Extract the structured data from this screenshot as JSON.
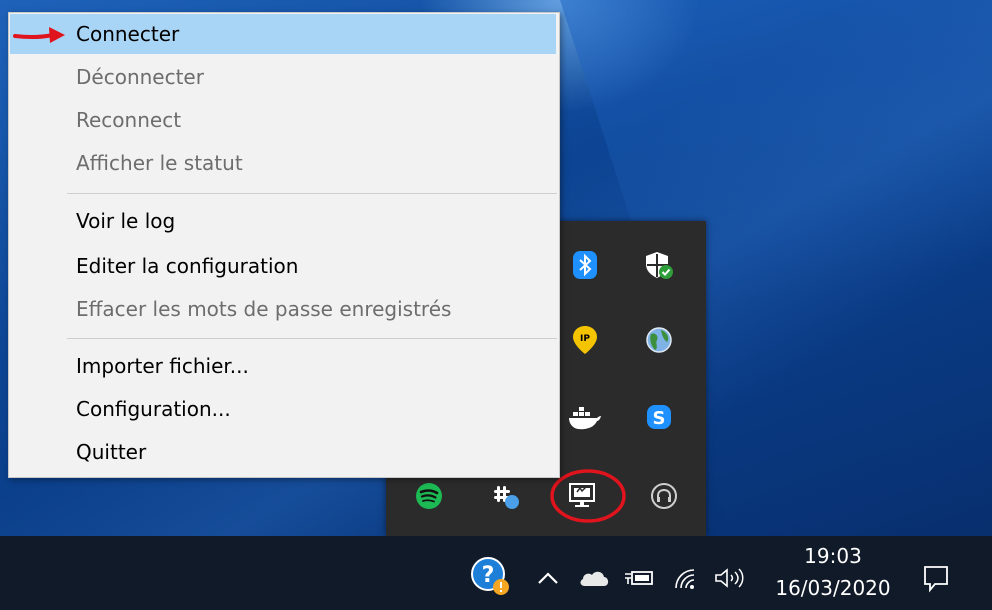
{
  "menu": {
    "items": [
      {
        "label": "Connecter",
        "state": "highlighted"
      },
      {
        "label": "Déconnecter",
        "state": "disabled"
      },
      {
        "label": "Reconnect",
        "state": "disabled"
      },
      {
        "label": "Afficher le statut",
        "state": "disabled"
      },
      {
        "label": "Voir le log",
        "state": "enabled"
      },
      {
        "label": "Editer la configuration",
        "state": "enabled"
      },
      {
        "label": "Effacer les mots de passe enregistrés",
        "state": "disabled"
      },
      {
        "label": "Importer fichier...",
        "state": "enabled"
      },
      {
        "label": "Configuration...",
        "state": "enabled"
      },
      {
        "label": "Quitter",
        "state": "enabled"
      }
    ]
  },
  "tray_overflow": {
    "icons": [
      {
        "name": "bluetooth-icon",
        "color": "#1e90ff"
      },
      {
        "name": "windows-security-icon",
        "color": "#ffffff"
      },
      {
        "name": "ip-location-icon",
        "color": "#f5c400"
      },
      {
        "name": "globe-icon",
        "color": "#7fb2e5"
      },
      {
        "name": "docker-icon",
        "color": "#ffffff"
      },
      {
        "name": "skype-icon",
        "color": "#1e90ff"
      },
      {
        "name": "spotify-icon",
        "color": "#1db954"
      },
      {
        "name": "slack-icon",
        "color": "#ffffff"
      },
      {
        "name": "openvpn-monitor-icon",
        "color": "#ffffff"
      },
      {
        "name": "headset-icon",
        "color": "#cccccc"
      }
    ]
  },
  "taskbar": {
    "time": "19:03",
    "date": "16/03/2020"
  },
  "colors": {
    "menu_highlight": "#a8d4f5",
    "annotation_red": "#e0141c",
    "taskbar_bg": "#101a28"
  }
}
